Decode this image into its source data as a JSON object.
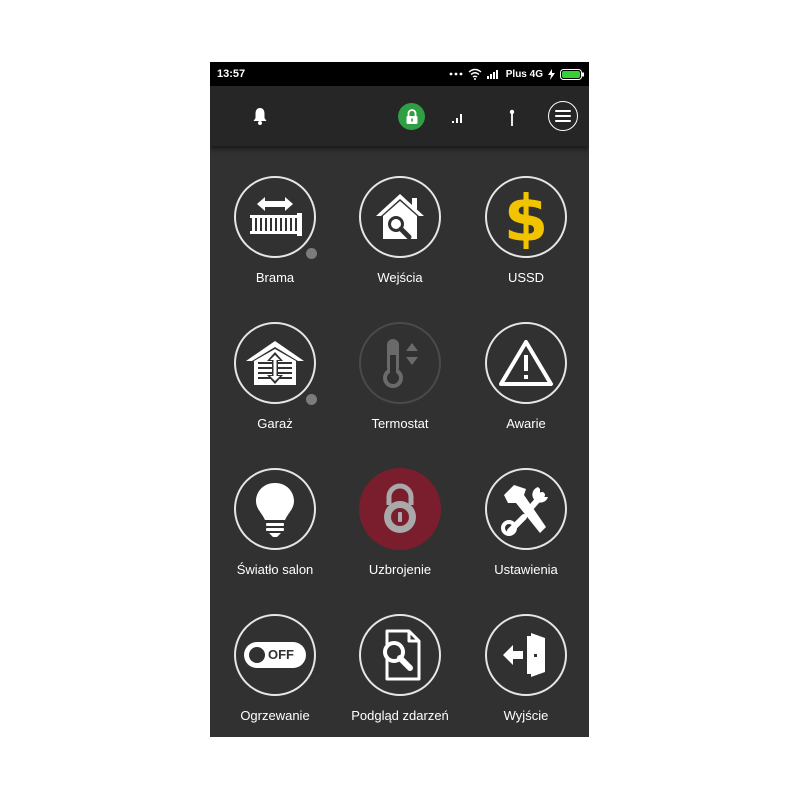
{
  "status_bar": {
    "time": "13:57",
    "carrier": "Plus 4G"
  },
  "toolbar": {
    "bell_icon": "bell-icon",
    "lock_icon": "lock-icon",
    "signal_icon": "signal-bars-icon",
    "antenna_icon": "antenna-icon",
    "menu_icon": "hamburger-menu-icon",
    "lock_color": "#2ea043"
  },
  "tiles": [
    {
      "label": "Brama",
      "icon": "gate-icon",
      "dot": true
    },
    {
      "label": "Wejścia",
      "icon": "house-search-icon",
      "dot": false
    },
    {
      "label": "USSD",
      "icon": "dollar-icon",
      "dot": false
    },
    {
      "label": "Garaż",
      "icon": "garage-icon",
      "dot": true
    },
    {
      "label": "Termostat",
      "icon": "thermometer-icon",
      "dot": false,
      "disabled": true
    },
    {
      "label": "Awarie",
      "icon": "warning-icon",
      "dot": false
    },
    {
      "label": "Światło salon",
      "icon": "lightbulb-icon",
      "dot": false
    },
    {
      "label": "Uzbrojenie",
      "icon": "padlock-icon",
      "dot": false,
      "armed": true
    },
    {
      "label": "Ustawienia",
      "icon": "tools-icon",
      "dot": false
    },
    {
      "label": "Ogrzewanie",
      "icon": "toggle-off-icon",
      "dot": false,
      "switch_text": "OFF"
    },
    {
      "label": "Podgląd zdarzeń",
      "icon": "document-search-icon",
      "dot": false
    },
    {
      "label": "Wyjście",
      "icon": "exit-door-icon",
      "dot": false
    }
  ],
  "colors": {
    "background": "#313131",
    "toolbar": "#262626",
    "dollar": "#f2c400",
    "armed": "#7a1e2e",
    "accent_green": "#2ea043"
  }
}
